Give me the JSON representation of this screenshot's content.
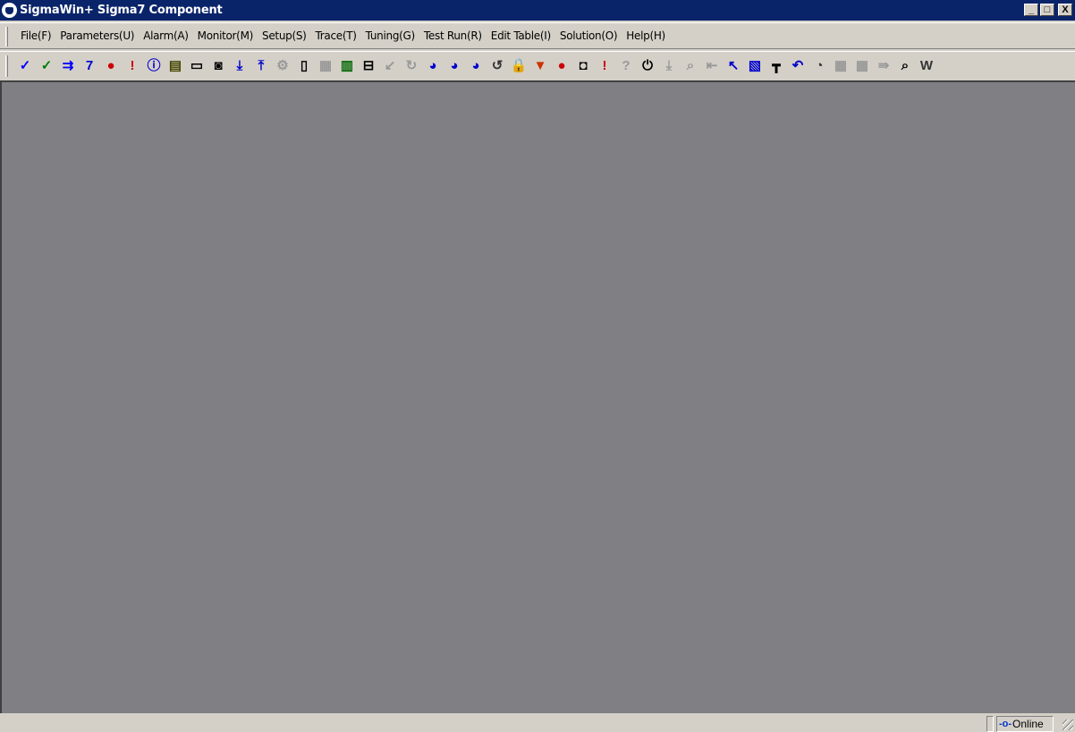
{
  "window": {
    "title": "SigmaWin+  Sigma7 Component",
    "minimize": "_",
    "maximize": "□",
    "close": "X"
  },
  "menu": [
    "File(F)",
    "Parameters(U)",
    "Alarm(A)",
    "Monitor(M)",
    "Setup(S)",
    "Trace(T)",
    "Tuning(G)",
    "Test Run(R)",
    "Edit Table(I)",
    "Solution(O)",
    "Help(H)"
  ],
  "toolbar": [
    {
      "name": "parameter-check-icon",
      "glyph": "✓",
      "color": "#0000ff"
    },
    {
      "name": "parameter-edit-icon",
      "glyph": "✓",
      "color": "#008000"
    },
    {
      "name": "parameter-transfer-icon",
      "glyph": "⇉",
      "color": "#0000ff"
    },
    {
      "name": "parameter-write-icon",
      "glyph": "7",
      "color": "#0000cc"
    },
    {
      "name": "alarm-display-icon",
      "glyph": "●",
      "color": "#cc0000"
    },
    {
      "name": "alarm-trace-icon",
      "glyph": "!",
      "color": "#cc0000"
    },
    {
      "name": "product-info-icon",
      "glyph": "ⓘ",
      "color": "#0000cc"
    },
    {
      "name": "monitor-icon",
      "glyph": "▤",
      "color": "#444400"
    },
    {
      "name": "monitor-panel-icon",
      "glyph": "▭",
      "color": "#000"
    },
    {
      "name": "origin-search-icon",
      "glyph": "◙",
      "color": "#000"
    },
    {
      "name": "download-icon",
      "glyph": "⤓",
      "color": "#0000cc"
    },
    {
      "name": "upload-icon",
      "glyph": "⤒",
      "color": "#0000cc"
    },
    {
      "name": "setup-gear-icon",
      "glyph": "⚙",
      "color": "#999"
    },
    {
      "name": "io-icon",
      "glyph": "▯",
      "color": "#000"
    },
    {
      "name": "io-disabled-icon",
      "glyph": "▦",
      "color": "#999"
    },
    {
      "name": "trace-meter-icon",
      "glyph": "▥",
      "color": "#006600"
    },
    {
      "name": "trace-signal-icon",
      "glyph": "⊟",
      "color": "#000"
    },
    {
      "name": "trace-disabled-icon",
      "glyph": "↙",
      "color": "#999"
    },
    {
      "name": "tuning-disabled-icon",
      "glyph": "↻",
      "color": "#999"
    },
    {
      "name": "tuning-advanced-icon",
      "glyph": "◕",
      "color": "#0000cc"
    },
    {
      "name": "tuning-one-param-icon",
      "glyph": "◕",
      "color": "#0000cc"
    },
    {
      "name": "tuning-custom-icon",
      "glyph": "◕",
      "color": "#0000cc"
    },
    {
      "name": "jog-icon",
      "glyph": "↺",
      "color": "#333"
    },
    {
      "name": "lock-icon",
      "glyph": "🔒",
      "color": "#cc9900"
    },
    {
      "name": "vibration-icon",
      "glyph": "▼",
      "color": "#cc3300"
    },
    {
      "name": "alarm-reset-icon",
      "glyph": "●",
      "color": "#cc0000"
    },
    {
      "name": "inspection-icon",
      "glyph": "◘",
      "color": "#000"
    },
    {
      "name": "life-monitor-icon",
      "glyph": "!",
      "color": "#cc0000"
    },
    {
      "name": "disabled-info-icon",
      "glyph": "?",
      "color": "#999"
    },
    {
      "name": "power-icon",
      "glyph": "⏻",
      "color": "#000"
    },
    {
      "name": "scale-disabled-icon",
      "glyph": "⤓",
      "color": "#999"
    },
    {
      "name": "search-disabled-icon",
      "glyph": "⌕",
      "color": "#999"
    },
    {
      "name": "ruler-disabled-icon",
      "glyph": "⇤",
      "color": "#999"
    },
    {
      "name": "motion-icon",
      "glyph": "↖",
      "color": "#0000cc"
    },
    {
      "name": "waveform-icon",
      "glyph": "▧",
      "color": "#0000cc"
    },
    {
      "name": "table-icon",
      "glyph": "┳",
      "color": "#000"
    },
    {
      "name": "rotate-icon",
      "glyph": "↶",
      "color": "#0000cc"
    },
    {
      "name": "motor-icon",
      "glyph": "◔",
      "color": "#333"
    },
    {
      "name": "grid-disabled-icon",
      "glyph": "▦",
      "color": "#999"
    },
    {
      "name": "grid2-disabled-icon",
      "glyph": "▦",
      "color": "#999"
    },
    {
      "name": "grid-transfer-disabled-icon",
      "glyph": "⇛",
      "color": "#999"
    },
    {
      "name": "zoom-icon",
      "glyph": "⌕",
      "color": "#000"
    },
    {
      "name": "chart-icon",
      "glyph": "W",
      "color": "#333"
    }
  ],
  "status": {
    "connection": "Online"
  }
}
